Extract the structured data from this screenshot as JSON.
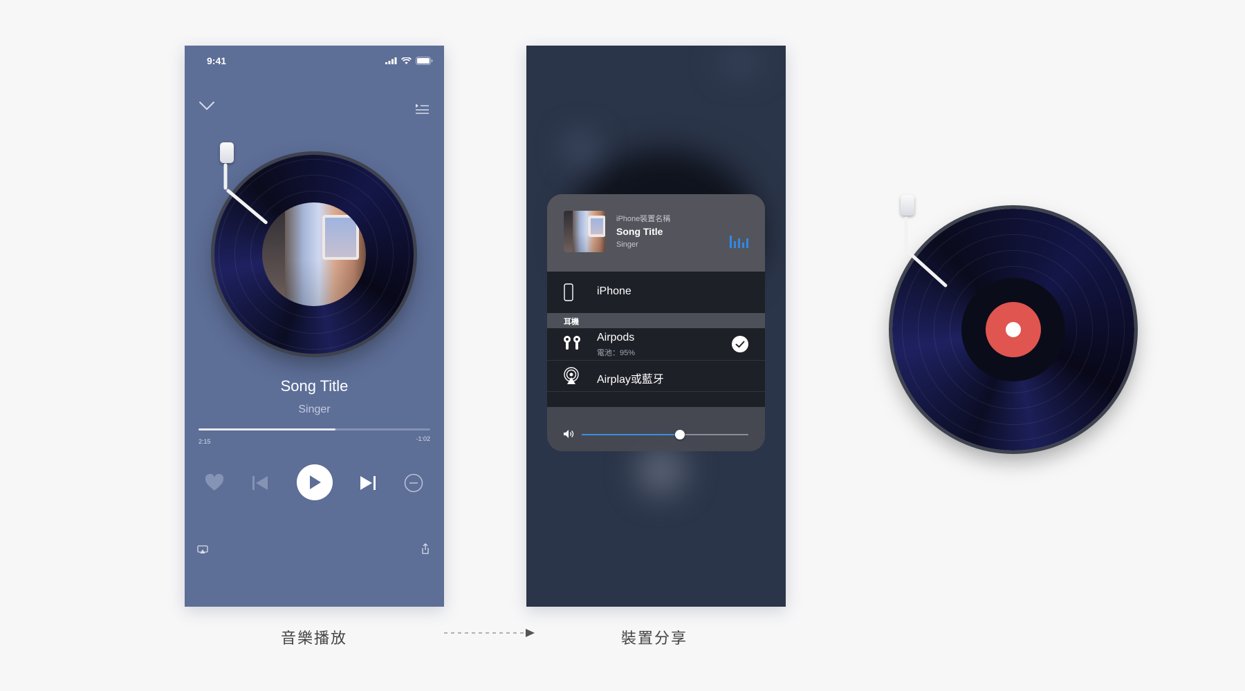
{
  "player": {
    "status_time": "9:41",
    "song_title": "Song Title",
    "singer": "Singer",
    "time_elapsed": "2:15",
    "time_remaining": "-1:02",
    "progress": 0.59
  },
  "share": {
    "device_name": "iPhone裝置名稱",
    "song_title": "Song Title",
    "singer": "Singer",
    "device_iphone": "iPhone",
    "section_headphones": "耳機",
    "airpods_label": "Airpods",
    "airpods_battery": "電池：95%",
    "airplay_label": "Airplay或藍牙",
    "volume": 0.59,
    "accent_color": "#2e8ae6"
  },
  "captions": {
    "left": "音樂播放",
    "right": "裝置分享"
  },
  "icons": [
    "chevron-down-icon",
    "queue-list-icon",
    "heart-icon",
    "previous-icon",
    "play-icon",
    "next-icon",
    "minus-circle-icon",
    "airplay-icon",
    "share-icon",
    "phone-icon",
    "airpods-icon",
    "checkmark-icon",
    "airplay-audio-icon",
    "speaker-icon",
    "signal-icon",
    "wifi-icon",
    "battery-icon"
  ],
  "colors": {
    "player_bg": "#5d6e97",
    "share_bg": "#2b3549",
    "record_center": "#e05550"
  }
}
